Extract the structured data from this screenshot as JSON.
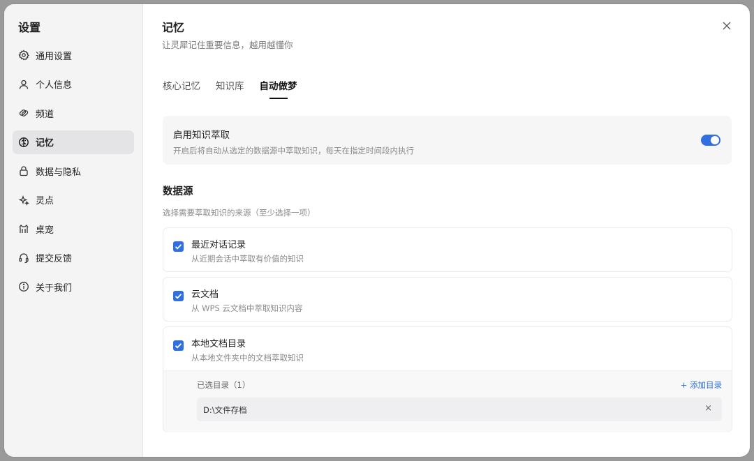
{
  "sidebar": {
    "title": "设置",
    "items": [
      {
        "label": "通用设置",
        "icon": "gear-icon",
        "active": false
      },
      {
        "label": "个人信息",
        "icon": "user-icon",
        "active": false
      },
      {
        "label": "频道",
        "icon": "channel-icon",
        "active": false
      },
      {
        "label": "记忆",
        "icon": "brain-icon",
        "active": true
      },
      {
        "label": "数据与隐私",
        "icon": "lock-icon",
        "active": false
      },
      {
        "label": "灵点",
        "icon": "sparkle-icon",
        "active": false
      },
      {
        "label": "桌宠",
        "icon": "pet-icon",
        "active": false
      },
      {
        "label": "提交反馈",
        "icon": "headset-icon",
        "active": false
      },
      {
        "label": "关于我们",
        "icon": "info-icon",
        "active": false
      }
    ]
  },
  "header": {
    "title": "记忆",
    "subtitle": "让灵犀记住重要信息，越用越懂你"
  },
  "tabs": [
    {
      "label": "核心记忆",
      "active": false
    },
    {
      "label": "知识库",
      "active": false
    },
    {
      "label": "自动做梦",
      "active": true
    }
  ],
  "enable": {
    "title": "启用知识萃取",
    "desc": "开启后将自动从选定的数据源中萃取知识，每天在指定时间段内执行",
    "on": true
  },
  "datasource": {
    "title": "数据源",
    "desc": "选择需要萃取知识的来源（至少选择一项）",
    "items": [
      {
        "title": "最近对话记录",
        "desc": "从近期会话中萃取有价值的知识",
        "checked": true
      },
      {
        "title": "云文档",
        "desc": "从 WPS 云文档中萃取知识内容",
        "checked": true
      },
      {
        "title": "本地文档目录",
        "desc": "从本地文件夹中的文档萃取知识",
        "checked": true
      }
    ],
    "dirs": {
      "label": "已选目录（1）",
      "add_label": "+ 添加目录",
      "paths": [
        "D:\\文件存档"
      ],
      "remove_label": "×"
    }
  },
  "colors": {
    "accent": "#2f6fe0"
  }
}
